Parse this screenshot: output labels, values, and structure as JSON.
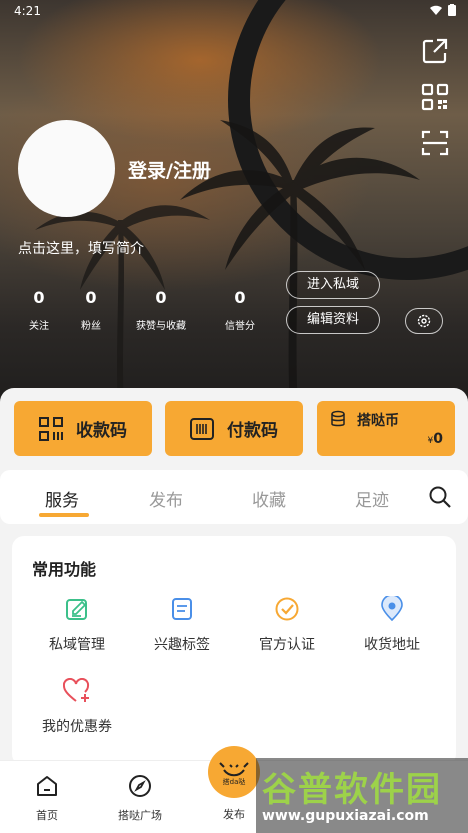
{
  "status_bar": {
    "time": "4:21"
  },
  "profile": {
    "login_label": "登录/注册",
    "bio_prompt": "点击这里，填写简介",
    "stats": [
      {
        "value": "0",
        "label": "关注"
      },
      {
        "value": "0",
        "label": "粉丝"
      },
      {
        "value": "0",
        "label": "获赞与收藏"
      },
      {
        "value": "0",
        "label": "信誉分"
      }
    ],
    "enter_private_label": "进入私域",
    "edit_profile_label": "编辑资料"
  },
  "payment": {
    "receive_label": "收款码",
    "pay_label": "付款码",
    "coin_label": "搭哒币",
    "coin_currency": "¥",
    "coin_value": "0"
  },
  "tabs": [
    {
      "label": "服务",
      "active": true
    },
    {
      "label": "发布",
      "active": false
    },
    {
      "label": "收藏",
      "active": false
    },
    {
      "label": "足迹",
      "active": false
    }
  ],
  "functions": {
    "title": "常用功能",
    "items": [
      {
        "label": "私域管理",
        "icon": "edit-square-icon",
        "color": "#3cc08a"
      },
      {
        "label": "兴趣标签",
        "icon": "document-icon",
        "color": "#4a8fe8"
      },
      {
        "label": "官方认证",
        "icon": "check-circle-icon",
        "color": "#f7a833"
      },
      {
        "label": "收货地址",
        "icon": "location-pin-icon",
        "color": "#4a8fe8"
      },
      {
        "label": "我的优惠券",
        "icon": "heart-plus-icon",
        "color": "#e8505b"
      }
    ]
  },
  "bottom_nav": {
    "items": [
      {
        "label": "首页",
        "icon": "home-icon"
      },
      {
        "label": "搭哒广场",
        "icon": "compass-icon"
      }
    ],
    "publish_label": "发布",
    "publish_logo_text": "搭da哒"
  },
  "watermark": {
    "big": "谷普软件园",
    "small": "www.gupuxiazai.com"
  },
  "colors": {
    "accent": "#f7a833",
    "text": "#222222",
    "muted": "#999999"
  }
}
